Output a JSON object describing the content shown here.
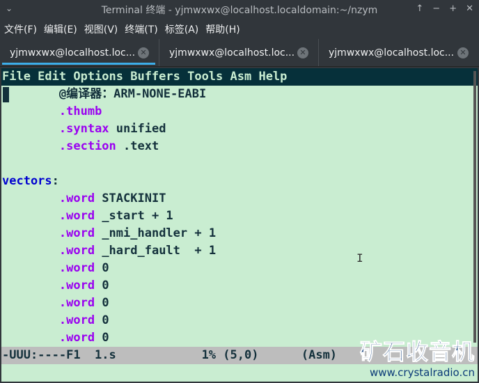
{
  "window": {
    "title": "Terminal 终端 - yjmwxwx@localhost.localdomain:~/nzym",
    "controls": [
      "↑",
      "−",
      "+",
      "✕"
    ],
    "menu_icon": "⌄"
  },
  "menu": [
    "文件(F)",
    "编辑(E)",
    "视图(V)",
    "终端(T)",
    "标签(A)",
    "帮助(H)"
  ],
  "tabs": [
    {
      "label": "yjmwxwx@localhost.loc..."
    },
    {
      "label": "yjmwxwx@localhost.loc..."
    },
    {
      "label": "yjmwxwx@localhost.loc..."
    }
  ],
  "tab_close": "✕",
  "emacs_menu": "File Edit Options Buffers Tools Asm Help",
  "code": [
    {
      "indent": "        ",
      "kw": "",
      "rest": "@编译器：ARM-NONE-EABI"
    },
    {
      "indent": "        ",
      "kw": ".thumb",
      "rest": ""
    },
    {
      "indent": "        ",
      "kw": ".syntax",
      "rest": " unified"
    },
    {
      "indent": "        ",
      "kw": ".section",
      "rest": " .text"
    },
    {
      "indent": "",
      "kw": "",
      "rest": ""
    },
    {
      "label": "vectors",
      "rest": ":"
    },
    {
      "indent": "        ",
      "kw": ".word",
      "rest": " STACKINIT"
    },
    {
      "indent": "        ",
      "kw": ".word",
      "rest": " _start + 1"
    },
    {
      "indent": "        ",
      "kw": ".word",
      "rest": " _nmi_handler + 1"
    },
    {
      "indent": "        ",
      "kw": ".word",
      "rest": " _hard_fault  + 1"
    },
    {
      "indent": "        ",
      "kw": ".word",
      "rest": " 0"
    },
    {
      "indent": "        ",
      "kw": ".word",
      "rest": " 0"
    },
    {
      "indent": "        ",
      "kw": ".word",
      "rest": " 0"
    },
    {
      "indent": "        ",
      "kw": ".word",
      "rest": " 0"
    },
    {
      "indent": "        ",
      "kw": ".word",
      "rest": " 0"
    }
  ],
  "modeline": "-UUU:----F1  1.s            1% (5,0)      (Asm)",
  "watermark": {
    "title": "矿石收音机",
    "url": "www.crystalradio.cn"
  }
}
